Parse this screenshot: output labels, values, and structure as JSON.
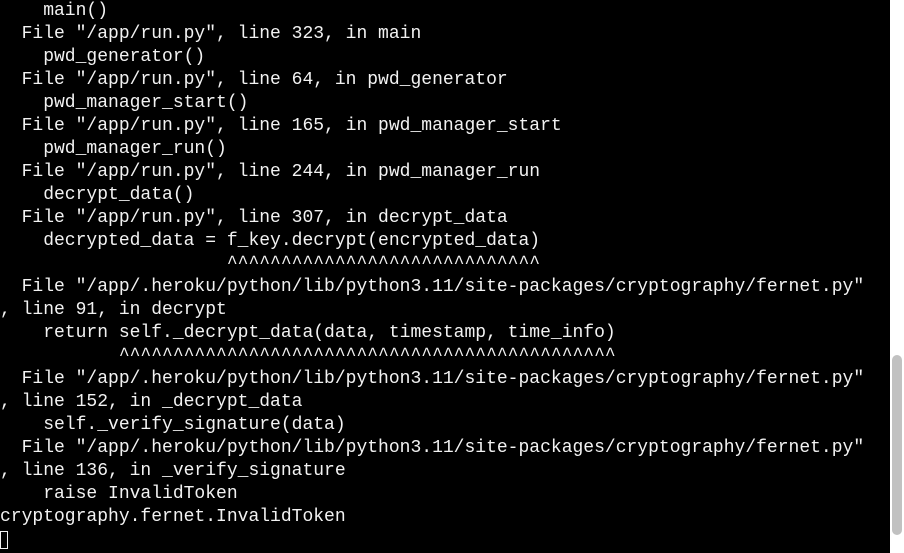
{
  "terminal": {
    "lines": [
      "    main()",
      "  File \"/app/run.py\", line 323, in main",
      "    pwd_generator()",
      "  File \"/app/run.py\", line 64, in pwd_generator",
      "    pwd_manager_start()",
      "  File \"/app/run.py\", line 165, in pwd_manager_start",
      "    pwd_manager_run()",
      "  File \"/app/run.py\", line 244, in pwd_manager_run",
      "    decrypt_data()",
      "  File \"/app/run.py\", line 307, in decrypt_data",
      "    decrypted_data = f_key.decrypt(encrypted_data)",
      "                     ^^^^^^^^^^^^^^^^^^^^^^^^^^^^^",
      "  File \"/app/.heroku/python/lib/python3.11/site-packages/cryptography/fernet.py\"",
      ", line 91, in decrypt",
      "    return self._decrypt_data(data, timestamp, time_info)",
      "           ^^^^^^^^^^^^^^^^^^^^^^^^^^^^^^^^^^^^^^^^^^^^^^",
      "  File \"/app/.heroku/python/lib/python3.11/site-packages/cryptography/fernet.py\"",
      ", line 152, in _decrypt_data",
      "    self._verify_signature(data)",
      "  File \"/app/.heroku/python/lib/python3.11/site-packages/cryptography/fernet.py\"",
      ", line 136, in _verify_signature",
      "    raise InvalidToken",
      "cryptography.fernet.InvalidToken"
    ]
  },
  "colors": {
    "background": "#000000",
    "text": "#f2f2f2",
    "scrollbar_track": "#ffffff",
    "scrollbar_thumb": "#c1c1c1"
  }
}
